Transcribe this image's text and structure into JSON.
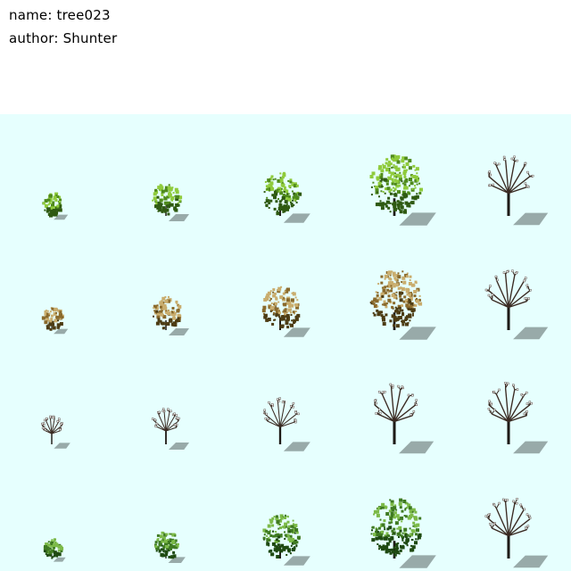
{
  "meta": {
    "name_label": "name: tree023",
    "author_label": "author: Shunter"
  },
  "colors": {
    "background_top": "#ffffff",
    "sheet_background": "#e6fffe",
    "shadow": "#8a9b9a",
    "trunk": "#1e1a16",
    "bare_branch": "#3a2a22",
    "bare_twig": "#ffffff"
  },
  "sprite_grid": {
    "columns": 5,
    "rows": 4,
    "seasons": [
      {
        "id": "summer",
        "foliage": [
          "#2f5a12",
          "#4f8a1c",
          "#8fcb3c"
        ],
        "sizes": [
          0.35,
          0.5,
          0.65,
          0.9,
          0.85
        ],
        "last_bare": true
      },
      {
        "id": "autumn",
        "foliage": [
          "#4d3c14",
          "#8a6a2c",
          "#c9ad6e"
        ],
        "sizes": [
          0.35,
          0.5,
          0.65,
          0.9,
          0.85
        ],
        "last_bare": true
      },
      {
        "id": "winter",
        "foliage": [],
        "sizes": [
          0.4,
          0.5,
          0.65,
          0.85,
          0.85
        ],
        "last_bare": true
      },
      {
        "id": "spring",
        "foliage": [
          "#1f4a12",
          "#3f7a22",
          "#7cba48"
        ],
        "sizes": [
          0.3,
          0.42,
          0.65,
          0.9,
          0.85
        ],
        "last_bare": true
      }
    ]
  }
}
